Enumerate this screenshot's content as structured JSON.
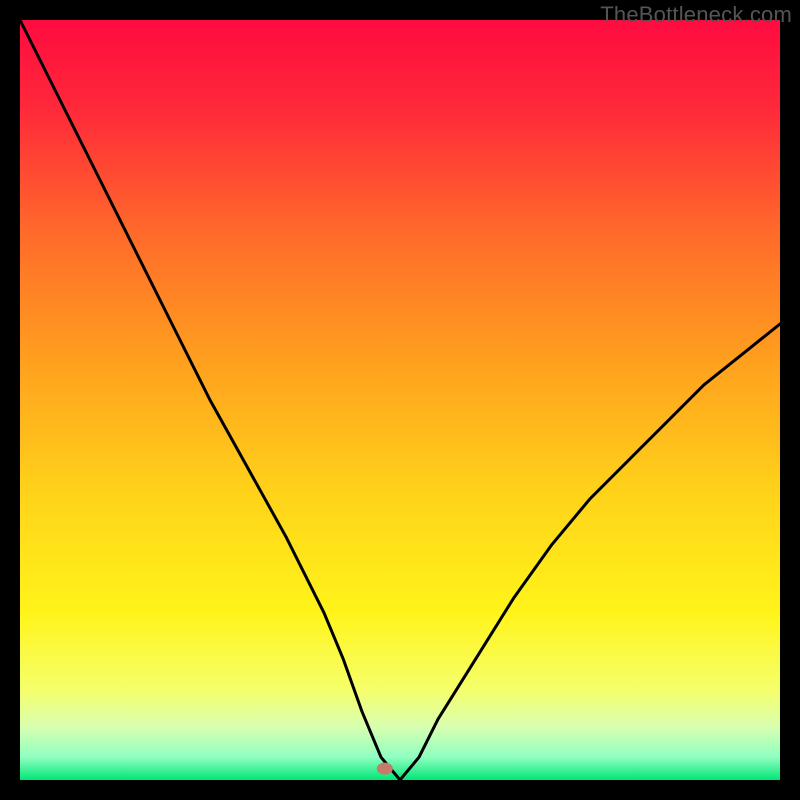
{
  "watermark": "TheBottleneck.com",
  "chart_data": {
    "type": "line",
    "title": "",
    "xlabel": "",
    "ylabel": "",
    "xlim": [
      0,
      100
    ],
    "ylim": [
      0,
      100
    ],
    "grid": false,
    "background": "vertical red-yellow-green gradient",
    "marker": {
      "x": 48,
      "y": 1.5,
      "color": "#c77a6b"
    },
    "series": [
      {
        "name": "bottleneck-curve",
        "x": [
          0,
          5,
          10,
          15,
          20,
          25,
          30,
          35,
          40,
          42.5,
          45,
          47.5,
          50,
          52.5,
          55,
          60,
          65,
          70,
          75,
          80,
          85,
          90,
          95,
          100
        ],
        "y": [
          100,
          90,
          80,
          70,
          60,
          50,
          41,
          32,
          22,
          16,
          9,
          3,
          0,
          3,
          8,
          16,
          24,
          31,
          37,
          42,
          47,
          52,
          56,
          60
        ]
      }
    ]
  }
}
